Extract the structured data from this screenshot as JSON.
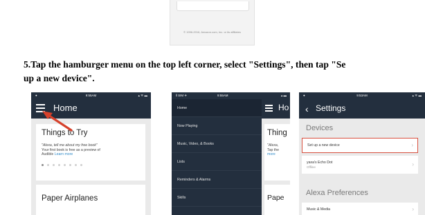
{
  "top_screenshot": {
    "copyright": "© 1996-2016, Amazon.com, Inc. or its affiliates"
  },
  "instruction": {
    "line1": "5.Tap the hamburger menu on the top left corner, select \"Settings\", then tap \"Se",
    "line2": "up a new device\"."
  },
  "screens": {
    "home": {
      "status_left": "●",
      "status_time": "9:55AM",
      "status_right": "▴ ᯤ ▬",
      "title": "Home",
      "card1_title": "Things to Try",
      "card1_quote": "\"Alexa, tell me about my free book\"",
      "card1_line2": "Your first book is free as a preview of",
      "card1_line3_text": "Audible ",
      "card1_link": "Learn more",
      "card2_title": "Paper Airplanes"
    },
    "menu": {
      "status_left": "ǁ SIM ✈",
      "status_time": "9:55AM",
      "status_right": "▴ ▬",
      "items": [
        {
          "label": "Home"
        },
        {
          "label": "Now Playing"
        },
        {
          "label": "Music, Video, & Books"
        },
        {
          "label": "Lists"
        },
        {
          "label": "Reminders & Alarms"
        },
        {
          "label": "Skills"
        }
      ],
      "peek_title": "Ho",
      "peek_card_title": "Thing",
      "peek_line1": "\"Alexa,",
      "peek_line2": "Tap the",
      "peek_line3": "more",
      "peek_card2_title": "Pape"
    },
    "settings": {
      "status_left": "●",
      "status_time": "9:53AM",
      "status_right": "▴ ᯤ ▬",
      "back_glyph": "‹",
      "title": "Settings",
      "devices_label": "Devices",
      "row1": "Set up a new device",
      "row2": "yaxa's Echo Dot",
      "row2_sub": "Offline",
      "prefs_label": "Alexa Preferences",
      "row3": "Music & Media"
    }
  },
  "colors": {
    "app_bar": "#232f3e",
    "highlight_border": "#d9503f",
    "arrow": "#d6412b",
    "link": "#2b88c7"
  }
}
